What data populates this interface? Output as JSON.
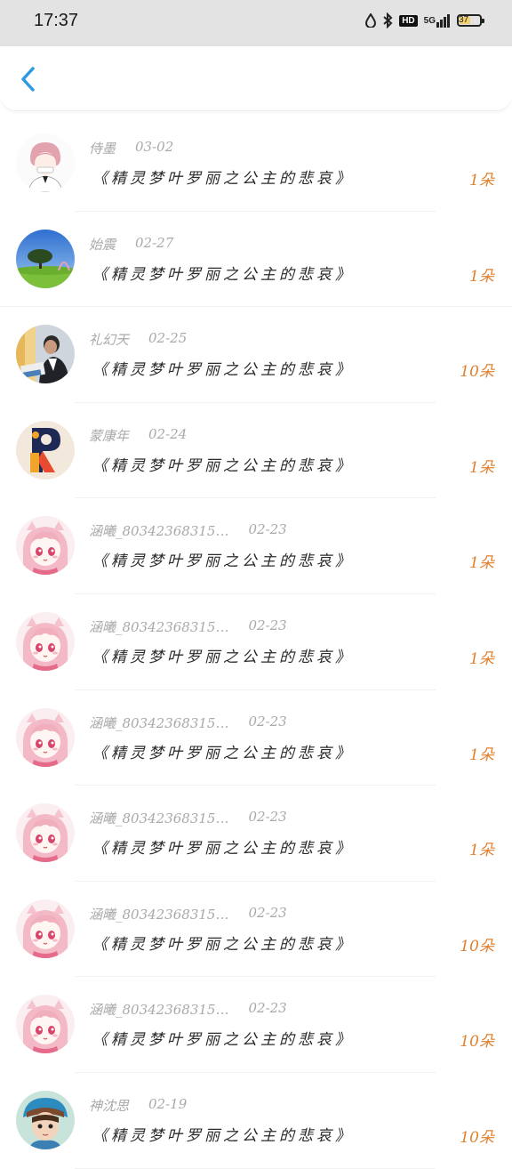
{
  "status_bar": {
    "time": "17:37",
    "hd": "HD",
    "network": "5G",
    "battery": "37"
  },
  "items": [
    {
      "user": "侍墨",
      "date": "03-02",
      "title": "《精灵梦叶罗丽之公主的悲哀》",
      "count": "1朵",
      "avatar": "boy-avatar"
    },
    {
      "user": "始震",
      "date": "02-27",
      "title": "《精灵梦叶罗丽之公主的悲哀》",
      "count": "1朵",
      "avatar": "landscape-avatar"
    },
    {
      "user": "礼幻天",
      "date": "02-25",
      "title": "《精灵梦叶罗丽之公主的悲哀》",
      "count": "10朵",
      "avatar": "office-avatar"
    },
    {
      "user": "蒙康年",
      "date": "02-24",
      "title": "《精灵梦叶罗丽之公主的悲哀》",
      "count": "1朵",
      "avatar": "letter-r-avatar"
    },
    {
      "user": "涵曦_80342368315…",
      "date": "02-23",
      "title": "《精灵梦叶罗丽之公主的悲哀》",
      "count": "1朵",
      "avatar": "anime-girl-avatar"
    },
    {
      "user": "涵曦_80342368315…",
      "date": "02-23",
      "title": "《精灵梦叶罗丽之公主的悲哀》",
      "count": "1朵",
      "avatar": "anime-girl-avatar"
    },
    {
      "user": "涵曦_80342368315…",
      "date": "02-23",
      "title": "《精灵梦叶罗丽之公主的悲哀》",
      "count": "1朵",
      "avatar": "anime-girl-avatar"
    },
    {
      "user": "涵曦_80342368315…",
      "date": "02-23",
      "title": "《精灵梦叶罗丽之公主的悲哀》",
      "count": "1朵",
      "avatar": "anime-girl-avatar"
    },
    {
      "user": "涵曦_80342368315…",
      "date": "02-23",
      "title": "《精灵梦叶罗丽之公主的悲哀》",
      "count": "10朵",
      "avatar": "anime-girl-avatar"
    },
    {
      "user": "涵曦_80342368315…",
      "date": "02-23",
      "title": "《精灵梦叶罗丽之公主的悲哀》",
      "count": "10朵",
      "avatar": "anime-girl-avatar"
    },
    {
      "user": "神沈思",
      "date": "02-19",
      "title": "《精灵梦叶罗丽之公主的悲哀》",
      "count": "10朵",
      "avatar": "child-avatar"
    }
  ],
  "colors": {
    "accent": "#2d9be0",
    "count": "#e1802f",
    "meta": "#a9a9a9"
  }
}
